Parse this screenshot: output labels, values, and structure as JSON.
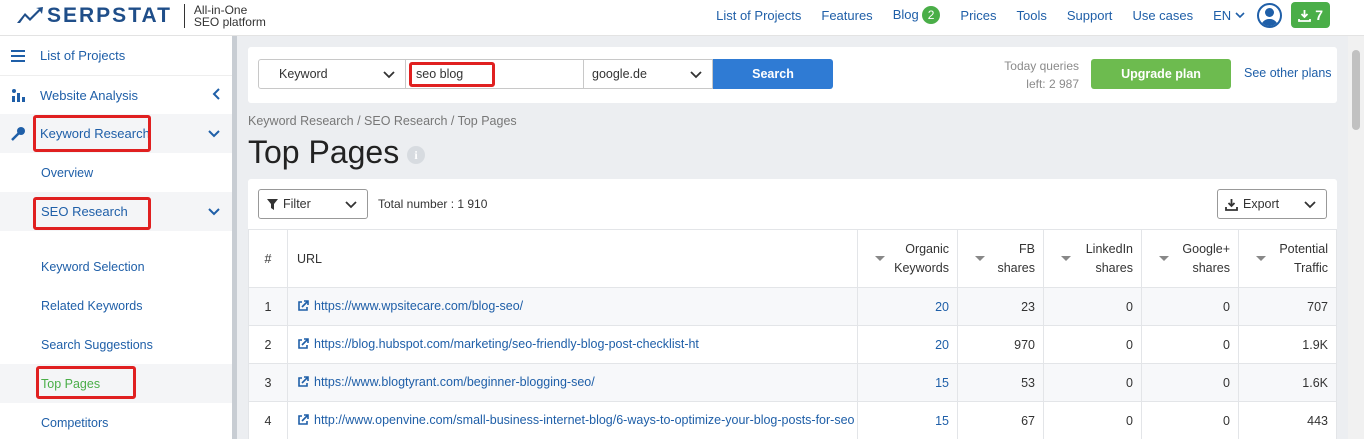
{
  "brand": {
    "name": "SERPSTAT",
    "tagline_line1": "All-in-One",
    "tagline_line2": "SEO platform"
  },
  "topnav": {
    "items": [
      "List of Projects",
      "Features",
      "Blog",
      "Prices",
      "Tools",
      "Support",
      "Use cases"
    ],
    "blog_badge": "2",
    "language": "EN",
    "downloads_count": "7"
  },
  "sidebar": {
    "list_of_projects": "List of Projects",
    "website_analysis": "Website Analysis",
    "keyword_research": "Keyword Research",
    "overview": "Overview",
    "seo_research": "SEO Research",
    "items": [
      "Keyword Selection",
      "Related Keywords",
      "Search Suggestions",
      "Top Pages",
      "Competitors"
    ]
  },
  "search": {
    "type": "Keyword",
    "query": "seo blog",
    "database": "google.de",
    "button": "Search",
    "queries_label": "Today queries",
    "queries_left": "left: 2 987",
    "upgrade": "Upgrade plan",
    "other_plans": "See other plans"
  },
  "page": {
    "breadcrumb": "Keyword Research / SEO Research / Top Pages",
    "title": "Top Pages",
    "filter": "Filter",
    "total": "Total number : 1 910",
    "export": "Export"
  },
  "table": {
    "headers": {
      "num": "#",
      "url": "URL",
      "organic_1": "Organic",
      "organic_2": "Keywords",
      "fb_1": "FB",
      "fb_2": "shares",
      "li_1": "LinkedIn",
      "li_2": "shares",
      "gp_1": "Google+",
      "gp_2": "shares",
      "pt_1": "Potential",
      "pt_2": "Traffic"
    },
    "rows": [
      {
        "n": "1",
        "url": "https://www.wpsitecare.com/blog-seo/",
        "organic": "20",
        "fb": "23",
        "li": "0",
        "gp": "0",
        "traffic": "707"
      },
      {
        "n": "2",
        "url": "https://blog.hubspot.com/marketing/seo-friendly-blog-post-checklist-ht",
        "organic": "20",
        "fb": "970",
        "li": "0",
        "gp": "0",
        "traffic": "1.9K"
      },
      {
        "n": "3",
        "url": "https://www.blogtyrant.com/beginner-blogging-seo/",
        "organic": "15",
        "fb": "53",
        "li": "0",
        "gp": "0",
        "traffic": "1.6K"
      },
      {
        "n": "4",
        "url": "http://www.openvine.com/small-business-internet-blog/6-ways-to-optimize-your-blog-posts-for-seo",
        "organic": "15",
        "fb": "67",
        "li": "0",
        "gp": "0",
        "traffic": "443"
      }
    ]
  },
  "colors": {
    "brand_blue": "#1f4e89",
    "link_blue": "#1f5fa8",
    "search_button": "#2f7bd4",
    "green": "#4aae48",
    "highlight_red": "#e02020"
  }
}
